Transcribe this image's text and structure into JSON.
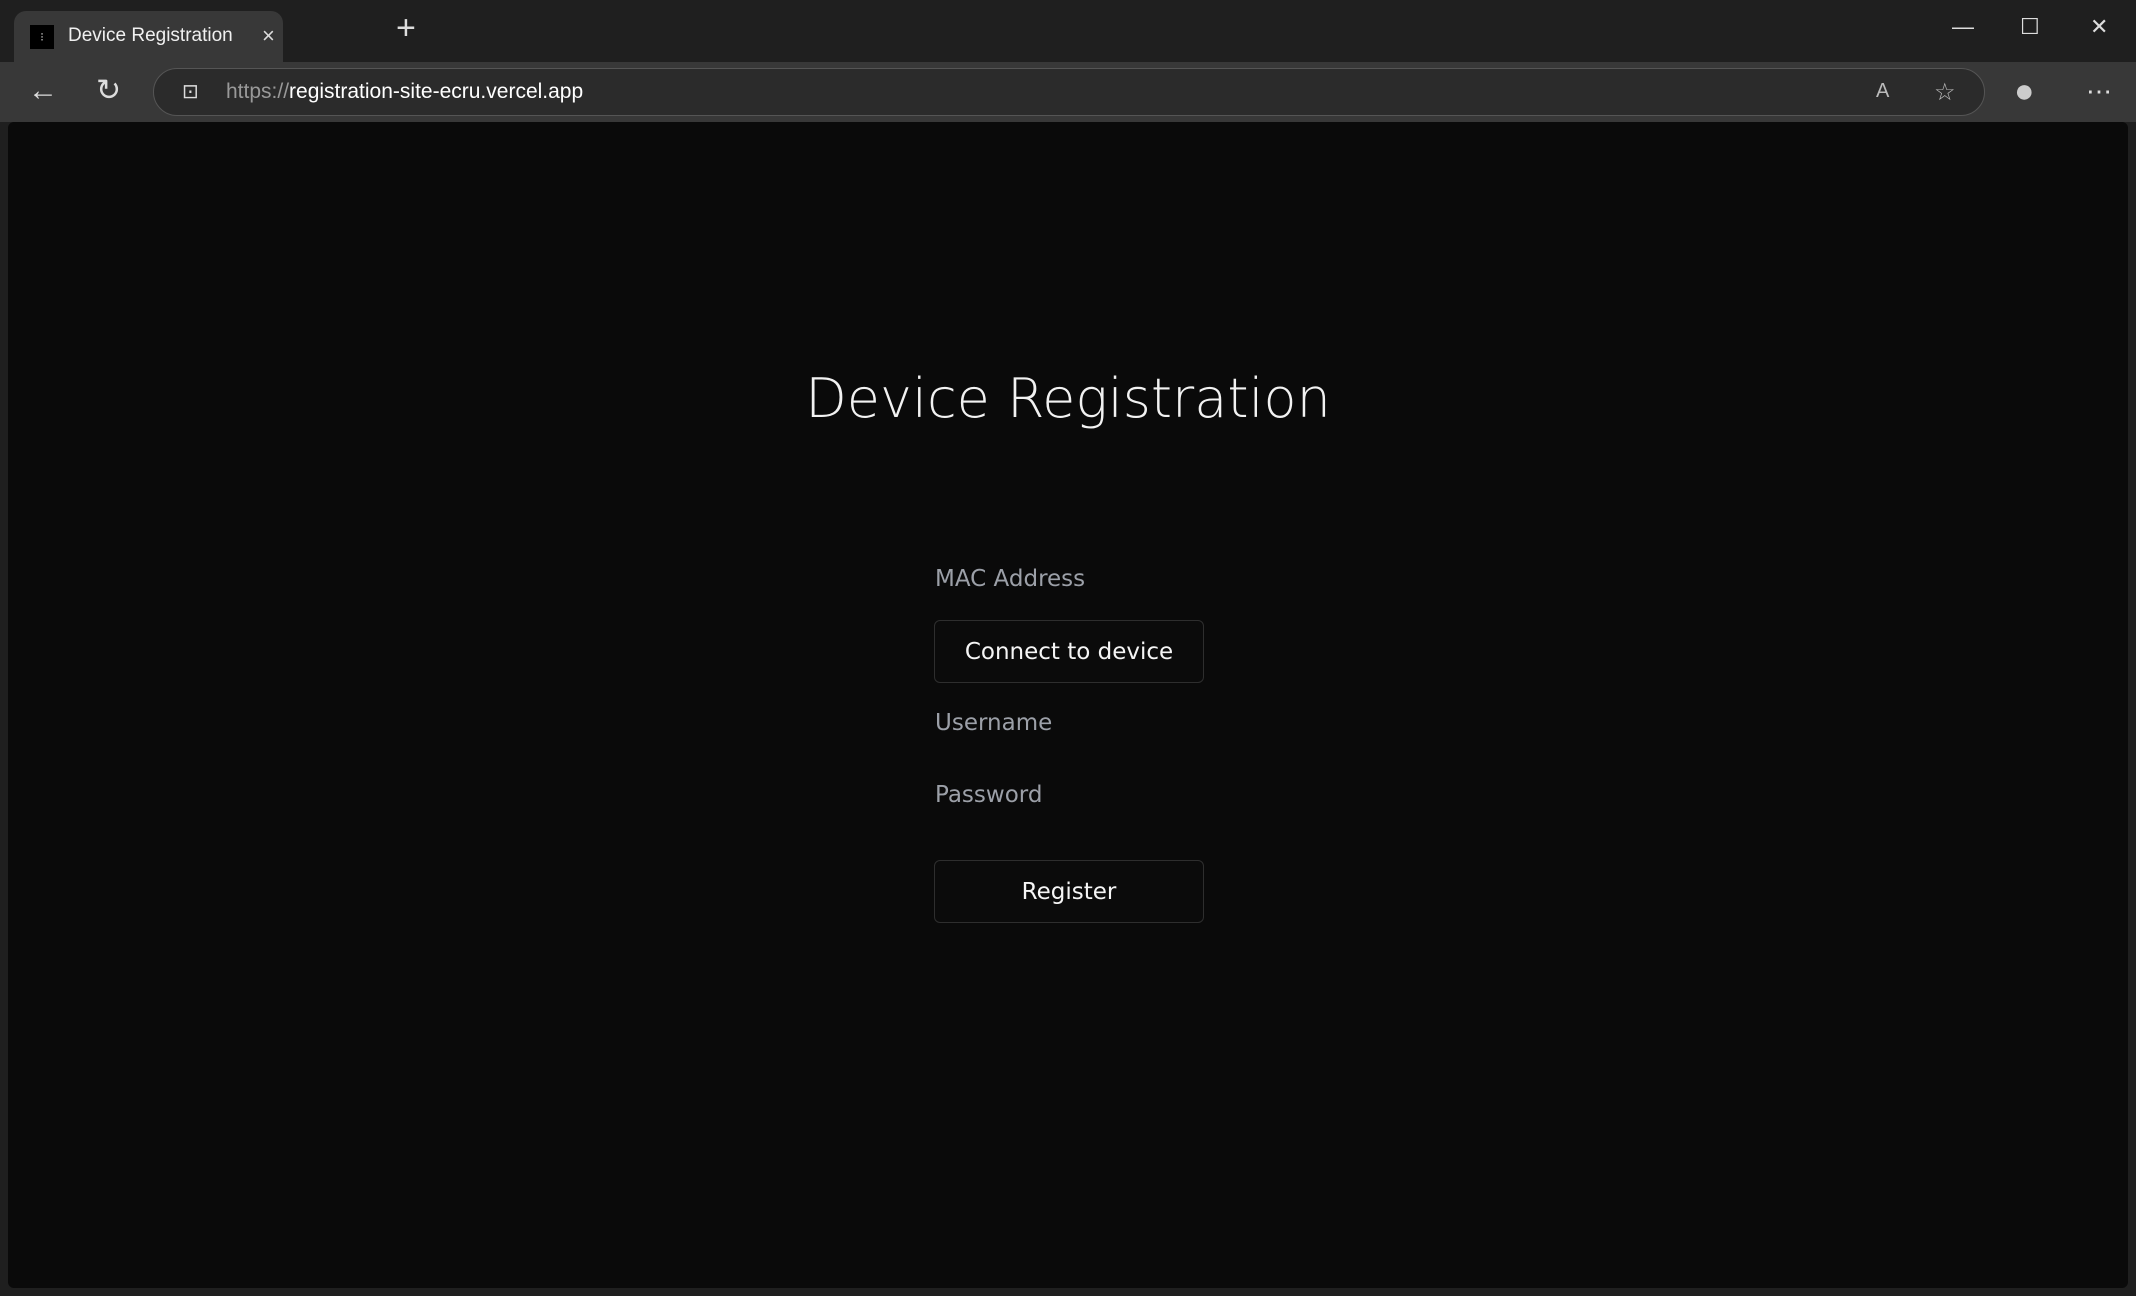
{
  "browser": {
    "tab_title": "Device Registration",
    "tab_close": "×",
    "new_tab": "+",
    "url_scheme": "https://",
    "url_host": "registration-site-ecru.vercel.app",
    "icons": {
      "back": "←",
      "refresh": "↻",
      "lock": "🔒",
      "read_aloud": "A",
      "favorite": "☆",
      "profile": "●",
      "menu": "⋯",
      "minimize": "—",
      "maximize": "☐",
      "close": "✕"
    }
  },
  "page": {
    "title": "Device Registration",
    "mac_label": "MAC Address",
    "connect_button": "Connect to device",
    "username_label": "Username",
    "password_label": "Password",
    "register_button": "Register"
  }
}
